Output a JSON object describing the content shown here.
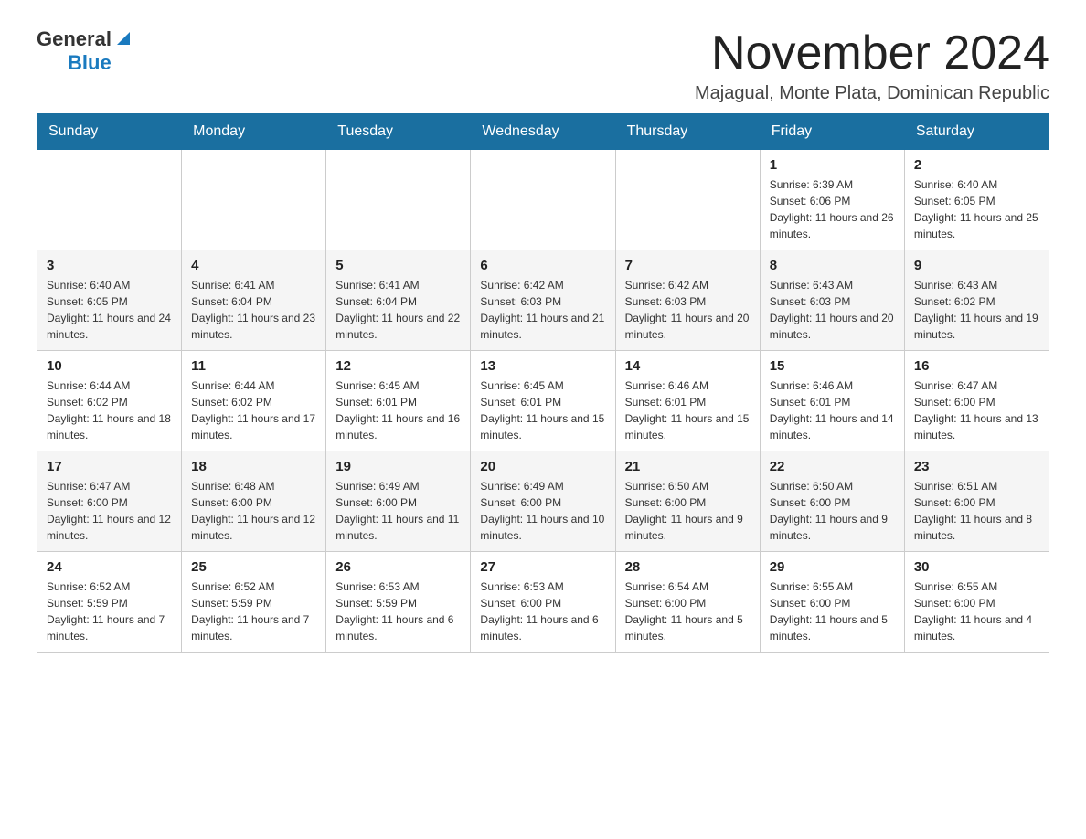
{
  "header": {
    "logo_general": "General",
    "logo_blue": "Blue",
    "title": "November 2024",
    "subtitle": "Majagual, Monte Plata, Dominican Republic"
  },
  "days_of_week": [
    "Sunday",
    "Monday",
    "Tuesday",
    "Wednesday",
    "Thursday",
    "Friday",
    "Saturday"
  ],
  "weeks": [
    [
      {
        "day": "",
        "info": ""
      },
      {
        "day": "",
        "info": ""
      },
      {
        "day": "",
        "info": ""
      },
      {
        "day": "",
        "info": ""
      },
      {
        "day": "",
        "info": ""
      },
      {
        "day": "1",
        "info": "Sunrise: 6:39 AM\nSunset: 6:06 PM\nDaylight: 11 hours and 26 minutes."
      },
      {
        "day": "2",
        "info": "Sunrise: 6:40 AM\nSunset: 6:05 PM\nDaylight: 11 hours and 25 minutes."
      }
    ],
    [
      {
        "day": "3",
        "info": "Sunrise: 6:40 AM\nSunset: 6:05 PM\nDaylight: 11 hours and 24 minutes."
      },
      {
        "day": "4",
        "info": "Sunrise: 6:41 AM\nSunset: 6:04 PM\nDaylight: 11 hours and 23 minutes."
      },
      {
        "day": "5",
        "info": "Sunrise: 6:41 AM\nSunset: 6:04 PM\nDaylight: 11 hours and 22 minutes."
      },
      {
        "day": "6",
        "info": "Sunrise: 6:42 AM\nSunset: 6:03 PM\nDaylight: 11 hours and 21 minutes."
      },
      {
        "day": "7",
        "info": "Sunrise: 6:42 AM\nSunset: 6:03 PM\nDaylight: 11 hours and 20 minutes."
      },
      {
        "day": "8",
        "info": "Sunrise: 6:43 AM\nSunset: 6:03 PM\nDaylight: 11 hours and 20 minutes."
      },
      {
        "day": "9",
        "info": "Sunrise: 6:43 AM\nSunset: 6:02 PM\nDaylight: 11 hours and 19 minutes."
      }
    ],
    [
      {
        "day": "10",
        "info": "Sunrise: 6:44 AM\nSunset: 6:02 PM\nDaylight: 11 hours and 18 minutes."
      },
      {
        "day": "11",
        "info": "Sunrise: 6:44 AM\nSunset: 6:02 PM\nDaylight: 11 hours and 17 minutes."
      },
      {
        "day": "12",
        "info": "Sunrise: 6:45 AM\nSunset: 6:01 PM\nDaylight: 11 hours and 16 minutes."
      },
      {
        "day": "13",
        "info": "Sunrise: 6:45 AM\nSunset: 6:01 PM\nDaylight: 11 hours and 15 minutes."
      },
      {
        "day": "14",
        "info": "Sunrise: 6:46 AM\nSunset: 6:01 PM\nDaylight: 11 hours and 15 minutes."
      },
      {
        "day": "15",
        "info": "Sunrise: 6:46 AM\nSunset: 6:01 PM\nDaylight: 11 hours and 14 minutes."
      },
      {
        "day": "16",
        "info": "Sunrise: 6:47 AM\nSunset: 6:00 PM\nDaylight: 11 hours and 13 minutes."
      }
    ],
    [
      {
        "day": "17",
        "info": "Sunrise: 6:47 AM\nSunset: 6:00 PM\nDaylight: 11 hours and 12 minutes."
      },
      {
        "day": "18",
        "info": "Sunrise: 6:48 AM\nSunset: 6:00 PM\nDaylight: 11 hours and 12 minutes."
      },
      {
        "day": "19",
        "info": "Sunrise: 6:49 AM\nSunset: 6:00 PM\nDaylight: 11 hours and 11 minutes."
      },
      {
        "day": "20",
        "info": "Sunrise: 6:49 AM\nSunset: 6:00 PM\nDaylight: 11 hours and 10 minutes."
      },
      {
        "day": "21",
        "info": "Sunrise: 6:50 AM\nSunset: 6:00 PM\nDaylight: 11 hours and 9 minutes."
      },
      {
        "day": "22",
        "info": "Sunrise: 6:50 AM\nSunset: 6:00 PM\nDaylight: 11 hours and 9 minutes."
      },
      {
        "day": "23",
        "info": "Sunrise: 6:51 AM\nSunset: 6:00 PM\nDaylight: 11 hours and 8 minutes."
      }
    ],
    [
      {
        "day": "24",
        "info": "Sunrise: 6:52 AM\nSunset: 5:59 PM\nDaylight: 11 hours and 7 minutes."
      },
      {
        "day": "25",
        "info": "Sunrise: 6:52 AM\nSunset: 5:59 PM\nDaylight: 11 hours and 7 minutes."
      },
      {
        "day": "26",
        "info": "Sunrise: 6:53 AM\nSunset: 5:59 PM\nDaylight: 11 hours and 6 minutes."
      },
      {
        "day": "27",
        "info": "Sunrise: 6:53 AM\nSunset: 6:00 PM\nDaylight: 11 hours and 6 minutes."
      },
      {
        "day": "28",
        "info": "Sunrise: 6:54 AM\nSunset: 6:00 PM\nDaylight: 11 hours and 5 minutes."
      },
      {
        "day": "29",
        "info": "Sunrise: 6:55 AM\nSunset: 6:00 PM\nDaylight: 11 hours and 5 minutes."
      },
      {
        "day": "30",
        "info": "Sunrise: 6:55 AM\nSunset: 6:00 PM\nDaylight: 11 hours and 4 minutes."
      }
    ]
  ]
}
